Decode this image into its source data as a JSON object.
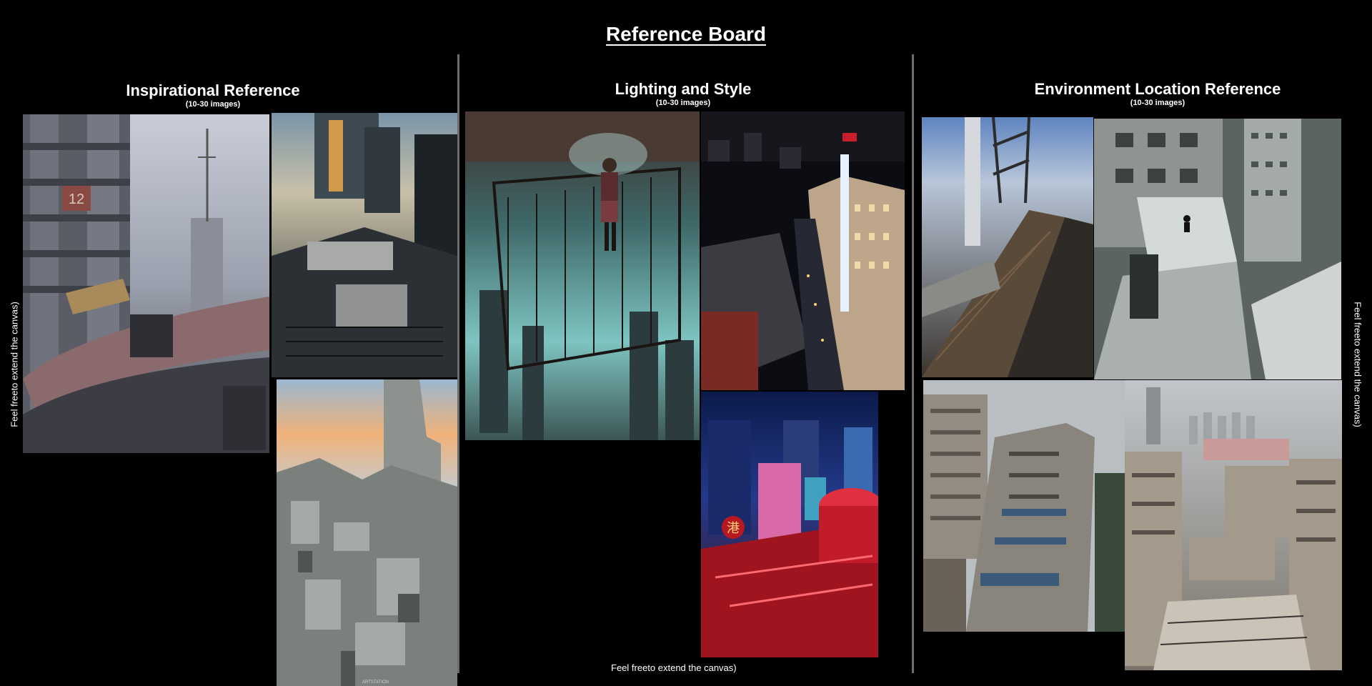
{
  "board": {
    "title": "Reference Board"
  },
  "columns": [
    {
      "title": "Inspirational Reference",
      "subtitle": "(10-30 images)"
    },
    {
      "title": "Lighting and Style",
      "subtitle": "(10-30 images)"
    },
    {
      "title": "Environment Location Reference",
      "subtitle": "(10-30 images)"
    }
  ],
  "notes": {
    "left": "Feel freeto extend the canvas)",
    "right": "Feel freeto extend the canvas)",
    "bottom": "Feel freeto extend the canvas)"
  },
  "images": {
    "insp_1_sign": "12",
    "insp_4_credit": "ARTSTATION",
    "light_4_sign": "港"
  },
  "colors": {
    "background": "#000000",
    "divider": "#6d6d6d",
    "text": "#ffffff"
  }
}
